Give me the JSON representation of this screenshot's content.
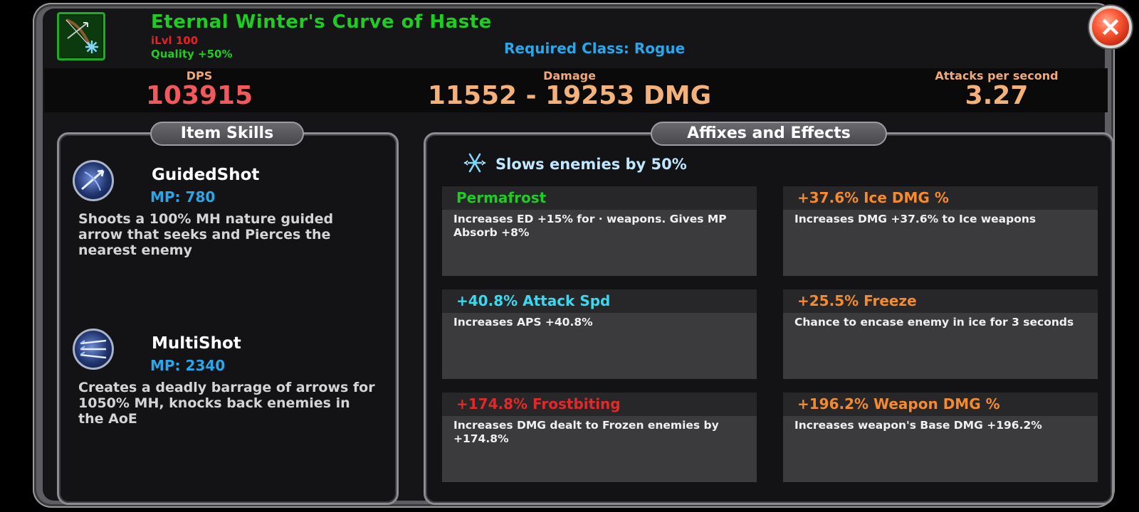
{
  "item": {
    "name": "Eternal Winter's Curve of Haste",
    "ilvl": "iLvl 100",
    "quality": "Quality +50%",
    "required_class": "Required Class: Rogue",
    "icon": "bow-snowflake-icon"
  },
  "close_button": {
    "label": "×",
    "icon": "close-icon"
  },
  "stats": {
    "dps": {
      "label": "DPS",
      "value": "103915",
      "color": "#f05a5c"
    },
    "damage": {
      "label": "Damage",
      "value": "11552 - 19253 DMG",
      "color": "#f4b27a"
    },
    "aps": {
      "label": "Attacks per second",
      "value": "3.27",
      "color": "#f4b27a"
    }
  },
  "item_skills": {
    "title": "Item Skills",
    "skills": [
      {
        "name": "GuidedShot",
        "mp": "MP: 780",
        "description": "Shoots a 100% MH nature guided arrow that seeks and Pierces the nearest enemy",
        "icon": "guided-shot-icon"
      },
      {
        "name": "MultiShot",
        "mp": "MP: 2340",
        "description": "Creates a deadly barrage of arrows for 1050% MH, knocks back enemies in the AoE",
        "icon": "multi-shot-icon"
      }
    ]
  },
  "affixes": {
    "title": "Affixes and Effects",
    "effect": {
      "text": "Slows enemies by 50%",
      "icon": "snowflake-icon"
    },
    "items": [
      {
        "title": "Permafrost",
        "color": "#1fcc24",
        "description": "Increases ED +15% for · weapons. Gives MP Absorb +8%"
      },
      {
        "title": "+37.6% Ice DMG %",
        "color": "#f58a2e",
        "description": "Increases DMG +37.6% to Ice weapons"
      },
      {
        "title": "+40.8% Attack Spd",
        "color": "#39d9f0",
        "description": "Increases APS +40.8%"
      },
      {
        "title": "+25.5% Freeze",
        "color": "#f58a2e",
        "description": "Chance to encase enemy in ice for 3 seconds"
      },
      {
        "title": "+174.8% Frostbiting",
        "color": "#e02a2a",
        "description": "Increases DMG dealt to Frozen enemies by +174.8%"
      },
      {
        "title": "+196.2% Weapon DMG %",
        "color": "#f58a2e",
        "description": "Increases weapon's Base DMG +196.2%"
      }
    ]
  }
}
